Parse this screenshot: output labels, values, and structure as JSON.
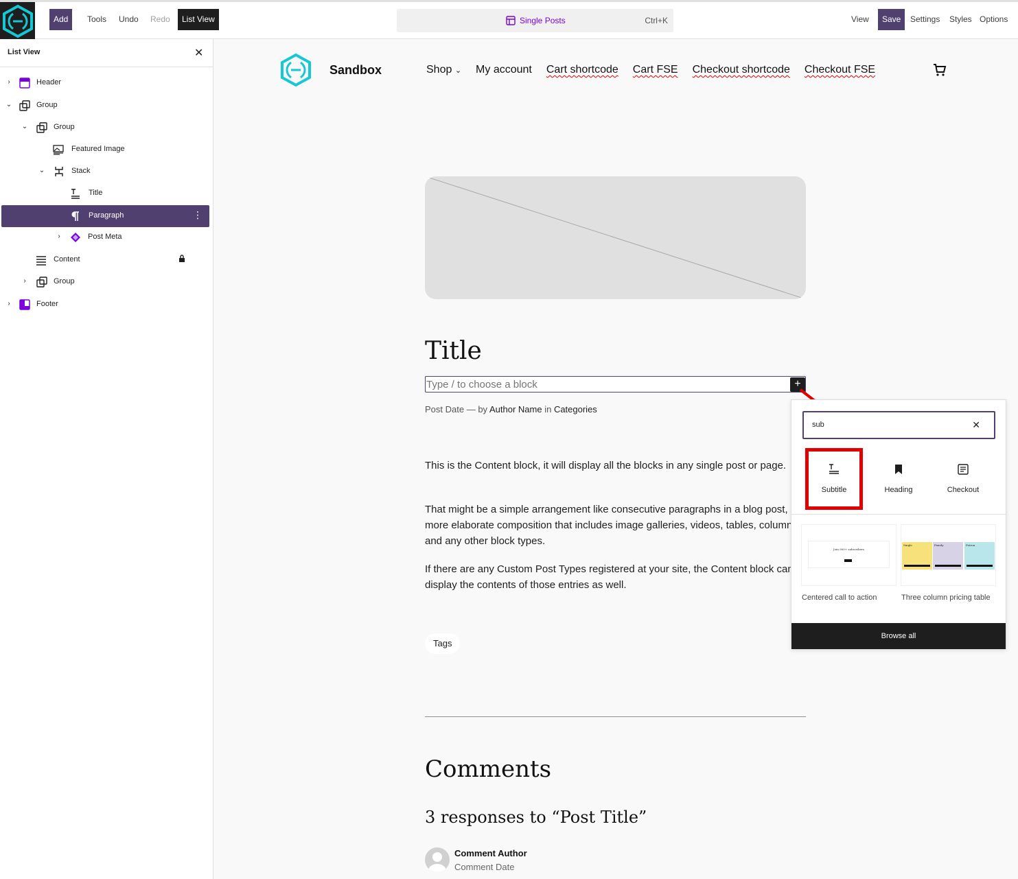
{
  "toolbar": {
    "add": "Add",
    "tools": "Tools",
    "undo": "Undo",
    "redo": "Redo",
    "list_view": "List View",
    "view": "View",
    "save": "Save",
    "settings": "Settings",
    "styles": "Styles",
    "options": "Options",
    "accent": "#50406f"
  },
  "command_bar": {
    "title": "Single Posts",
    "shortcut": "Ctrl+K",
    "icon": "layout-icon"
  },
  "list_view": {
    "title": "List View",
    "items": [
      {
        "label": "Header",
        "icon": "header-icon"
      },
      {
        "label": "Group",
        "icon": "group-icon"
      },
      {
        "label": "Group",
        "icon": "group-icon"
      },
      {
        "label": "Featured Image",
        "icon": "featured-image-icon"
      },
      {
        "label": "Stack",
        "icon": "stack-icon"
      },
      {
        "label": "Title",
        "icon": "title-icon"
      },
      {
        "label": "Paragraph",
        "icon": "paragraph-icon"
      },
      {
        "label": "Post Meta",
        "icon": "post-meta-icon"
      },
      {
        "label": "Content",
        "icon": "content-icon"
      },
      {
        "label": "Group",
        "icon": "group-icon"
      },
      {
        "label": "Footer",
        "icon": "footer-icon"
      }
    ]
  },
  "site": {
    "name": "Sandbox",
    "nav": [
      "Shop",
      "My account",
      "Cart shortcode",
      "Cart FSE",
      "Checkout shortcode",
      "Checkout FSE"
    ]
  },
  "post": {
    "title": "Title",
    "paragraph_placeholder": "Type / to choose a block",
    "meta_date": "Post Date",
    "meta_by": "— by",
    "meta_author": "Author Name",
    "meta_in": "in",
    "meta_categories": "Categories",
    "content": [
      "This is the Content block, it will display all the blocks in any single post or page.",
      "That might be a simple arrangement like consecutive paragraphs in a blog post, or a more elaborate composition that includes image galleries, videos, tables, columns, and any other block types.",
      "If there are any Custom Post Types registered at your site, the Content block can display the contents of those entries as well."
    ],
    "tags": "Tags",
    "comments_heading": "Comments",
    "responses": "3 responses to “Post Title”",
    "comment_author": "Comment Author",
    "comment_date": "Comment Date"
  },
  "inserter": {
    "search_value": "sub",
    "blocks": [
      {
        "label": "Subtitle",
        "icon": "subtitle-icon"
      },
      {
        "label": "Heading",
        "icon": "bookmark-icon"
      },
      {
        "label": "Checkout",
        "icon": "checkout-icon"
      }
    ],
    "patterns": [
      {
        "label": "Centered call to action",
        "preview_text": "Join 900+ subscribers"
      },
      {
        "label": "Three column pricing table",
        "columns": [
          "Single",
          "Family",
          "Patron"
        ]
      }
    ],
    "browse_all": "Browse all"
  }
}
